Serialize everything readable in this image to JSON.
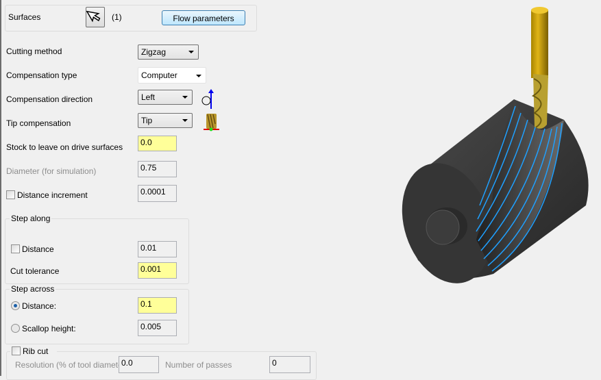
{
  "surfaces": {
    "label": "Surfaces",
    "count": "(1)",
    "select_icon": "arrow-cursor-icon",
    "flow_button": "Flow parameters"
  },
  "fields": {
    "cutting_method": {
      "label": "Cutting method",
      "value": "Zigzag"
    },
    "compensation_type": {
      "label": "Compensation type",
      "value": "Computer"
    },
    "compensation_direction": {
      "label": "Compensation direction",
      "value": "Left",
      "icon": "left-compensation-icon"
    },
    "tip_compensation": {
      "label": "Tip compensation",
      "value": "Tip",
      "icon": "tool-tip-icon"
    },
    "stock_to_leave": {
      "label": "Stock to leave on drive surfaces",
      "value": "0.0"
    },
    "diameter": {
      "label": "Diameter (for simulation)",
      "value": "0.75"
    },
    "distance_increment": {
      "label": "Distance increment",
      "value": "0.0001",
      "checked": false
    }
  },
  "step_along": {
    "title": "Step along",
    "distance_label": "Distance",
    "distance_checked": false,
    "distance_value": "0.01",
    "cut_tolerance_label": "Cut tolerance",
    "cut_tolerance_value": "0.001"
  },
  "step_across": {
    "title": "Step across",
    "distance_label": "Distance:",
    "distance_value": "0.1",
    "distance_selected": true,
    "scallop_label": "Scallop height:",
    "scallop_value": "0.005"
  },
  "rib_cut": {
    "title": "Rib cut",
    "checked": false,
    "resolution_label": "Resolution (% of tool diameter)",
    "resolution_value": "0.0",
    "passes_label": "Number of passes",
    "passes_value": "0"
  },
  "colors": {
    "highlight_input": "#ffff99",
    "toolpath": "#1fa0ff",
    "tool": "#c8a000",
    "stock": "#3a3a3a"
  }
}
